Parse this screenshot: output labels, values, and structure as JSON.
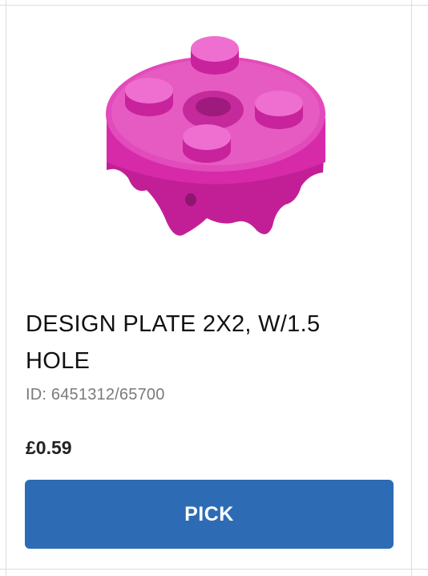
{
  "product": {
    "name": "DESIGN PLATE 2X2, W/1.5 HOLE",
    "id_text": "ID: 6451312/65700",
    "price": "£0.59",
    "image_icon": "lego-design-plate-2x2-image",
    "color": "#d62aa8"
  },
  "actions": {
    "pick_label": "PICK"
  },
  "colors": {
    "button_bg": "#2d6bb5",
    "button_text": "#ffffff"
  }
}
